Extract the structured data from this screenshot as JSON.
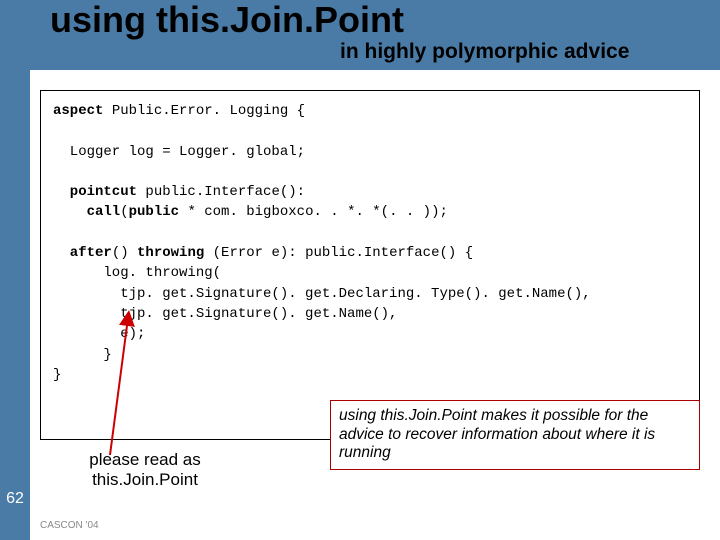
{
  "title": "using this.Join.Point",
  "subtitle": "in highly polymorphic advice",
  "code": {
    "l1": {
      "kw": "aspect",
      "rest": " Public.Error. Logging {"
    },
    "l2": "  Logger log = Logger. global;",
    "l3": {
      "kw": "  pointcut",
      "rest": " public.Interface():"
    },
    "l4": {
      "kw1": "    call",
      "mid": "(",
      "kw2": "public",
      "rest": " * com. bigboxco. . *. *(. . ));"
    },
    "l5": {
      "kw1": "  after",
      "mid": "() ",
      "kw2": "throwing",
      "rest": " (Error e): public.Interface() {"
    },
    "l6": "      log. throwing(",
    "l7": "        tjp. get.Signature(). get.Declaring. Type(). get.Name(),",
    "l8": "        tjp. get.Signature(). get.Name(),",
    "l9": "        e);",
    "l10": "      }",
    "l11": "}"
  },
  "callout": "using this.Join.Point makes it possible for the advice to recover information about where it is running",
  "read_as_1": "please read as",
  "read_as_2": "this.Join.Point",
  "page_number": "62",
  "footer": "CASCON '04"
}
